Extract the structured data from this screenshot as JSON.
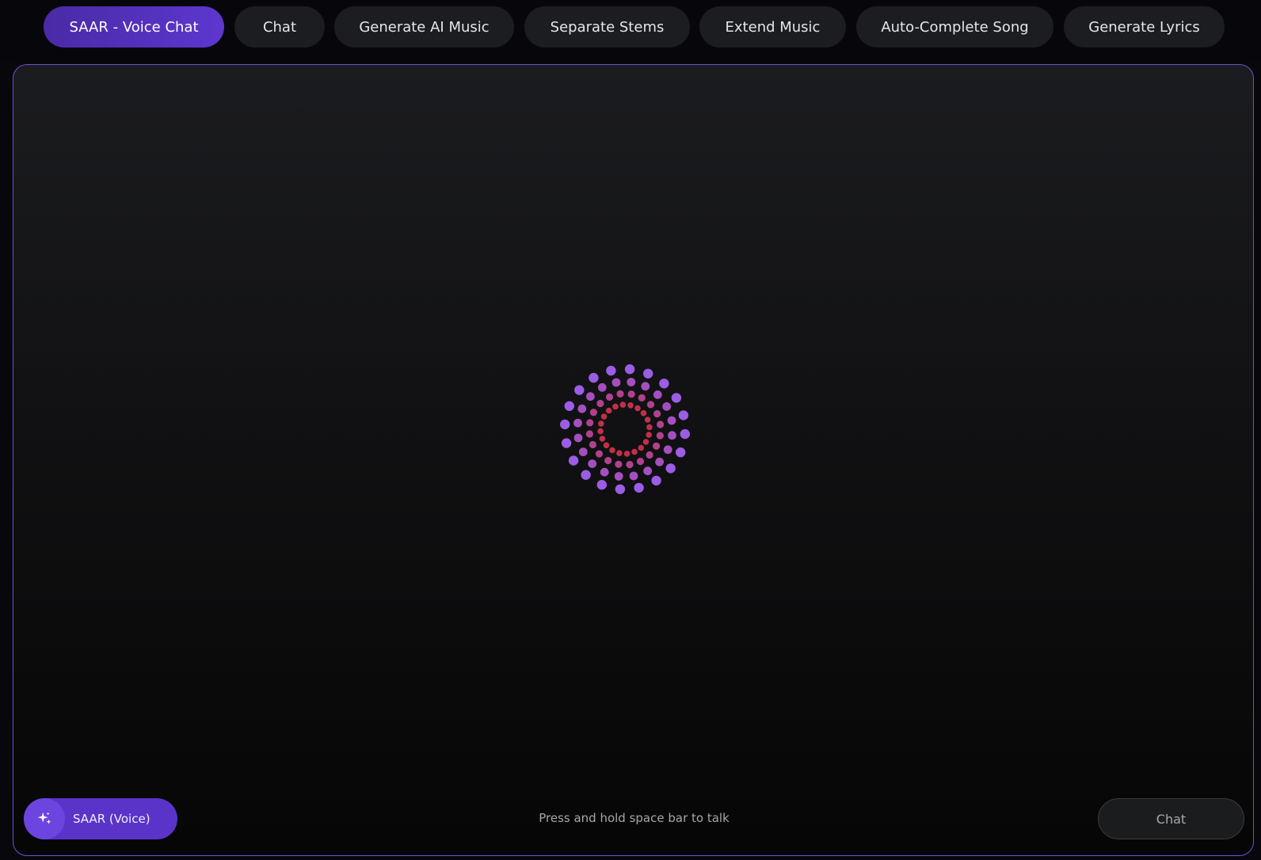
{
  "nav": {
    "tabs": [
      {
        "label": "SAAR - Voice Chat",
        "active": true
      },
      {
        "label": "Chat",
        "active": false
      },
      {
        "label": "Generate AI Music",
        "active": false
      },
      {
        "label": "Separate Stems",
        "active": false
      },
      {
        "label": "Extend Music",
        "active": false
      },
      {
        "label": "Auto-Complete Song",
        "active": false
      },
      {
        "label": "Generate Lyrics",
        "active": false
      }
    ]
  },
  "main": {
    "visualizer": {
      "icon": "voice-orb-visualizer",
      "colors": {
        "outer": "#9b5de5",
        "inner": "#c0304a"
      }
    },
    "voice_button": {
      "label": "SAAR (Voice)",
      "icon": "sparkles-icon"
    },
    "hint": "Press and hold space bar to talk",
    "chat_button": {
      "label": "Chat"
    }
  },
  "colors": {
    "accent": "#5d37cf",
    "panel_border": "#6f4fd0",
    "background": "#08070c"
  }
}
